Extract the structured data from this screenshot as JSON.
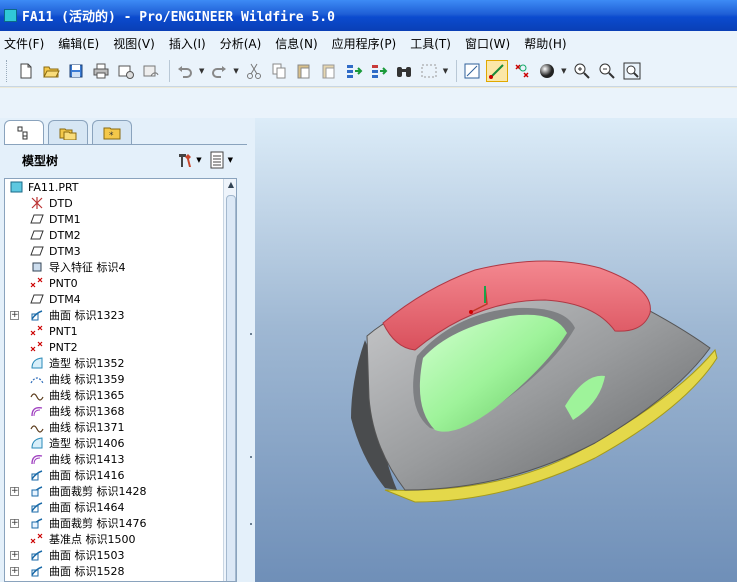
{
  "window": {
    "title": "FA11 (活动的) - Pro/ENGINEER Wildfire 5.0"
  },
  "menu": [
    "文件(F)",
    "编辑(E)",
    "视图(V)",
    "插入(I)",
    "分析(A)",
    "信息(N)",
    "应用程序(P)",
    "工具(T)",
    "窗口(W)",
    "帮助(H)"
  ],
  "panel": {
    "title": "模型树"
  },
  "tree": {
    "root": "FA11.PRT",
    "items": [
      {
        "label": "DTD",
        "icon": "datum-csys-icon",
        "expand": false
      },
      {
        "label": "DTM1",
        "icon": "datum-plane-icon",
        "expand": false
      },
      {
        "label": "DTM2",
        "icon": "datum-plane-icon",
        "expand": false
      },
      {
        "label": "DTM3",
        "icon": "datum-plane-icon",
        "expand": false
      },
      {
        "label": "导入特征 标识4",
        "icon": "import-feature-icon",
        "expand": false
      },
      {
        "label": "PNT0",
        "icon": "datum-point-icon",
        "expand": false
      },
      {
        "label": "DTM4",
        "icon": "datum-plane-icon",
        "expand": false
      },
      {
        "label": "曲面 标识1323",
        "icon": "surface-icon",
        "expand": true
      },
      {
        "label": "PNT1",
        "icon": "datum-point-icon",
        "expand": false
      },
      {
        "label": "PNT2",
        "icon": "datum-point-icon",
        "expand": false
      },
      {
        "label": "造型 标识1352",
        "icon": "style-icon",
        "expand": false
      },
      {
        "label": "曲线 标识1359",
        "icon": "curve-dashed-icon",
        "expand": false
      },
      {
        "label": "曲线 标识1365",
        "icon": "curve-icon",
        "expand": false
      },
      {
        "label": "曲线 标识1368",
        "icon": "curve-purple-icon",
        "expand": false
      },
      {
        "label": "曲线 标识1371",
        "icon": "curve-icon",
        "expand": false
      },
      {
        "label": "造型 标识1406",
        "icon": "style-icon",
        "expand": false
      },
      {
        "label": "曲线 标识1413",
        "icon": "curve-purple-icon",
        "expand": false
      },
      {
        "label": "曲面 标识1416",
        "icon": "surface-icon",
        "expand": false
      },
      {
        "label": "曲面裁剪 标识1428",
        "icon": "surface-trim-icon",
        "expand": true
      },
      {
        "label": "曲面 标识1464",
        "icon": "surface-icon",
        "expand": false
      },
      {
        "label": "曲面裁剪 标识1476",
        "icon": "surface-trim-icon",
        "expand": true
      },
      {
        "label": "基准点 标识1500",
        "icon": "datum-point-icon",
        "expand": false
      },
      {
        "label": "曲面 标识1503",
        "icon": "surface-icon",
        "expand": true
      },
      {
        "label": "曲面 标识1528",
        "icon": "surface-icon",
        "expand": true
      }
    ]
  },
  "colors": {
    "title_bar": "#0a3fb5",
    "handle": "#ef6b74",
    "grip": "#9ef39a",
    "body": "#9a9c9e",
    "soleplate": "#e4d84a"
  }
}
